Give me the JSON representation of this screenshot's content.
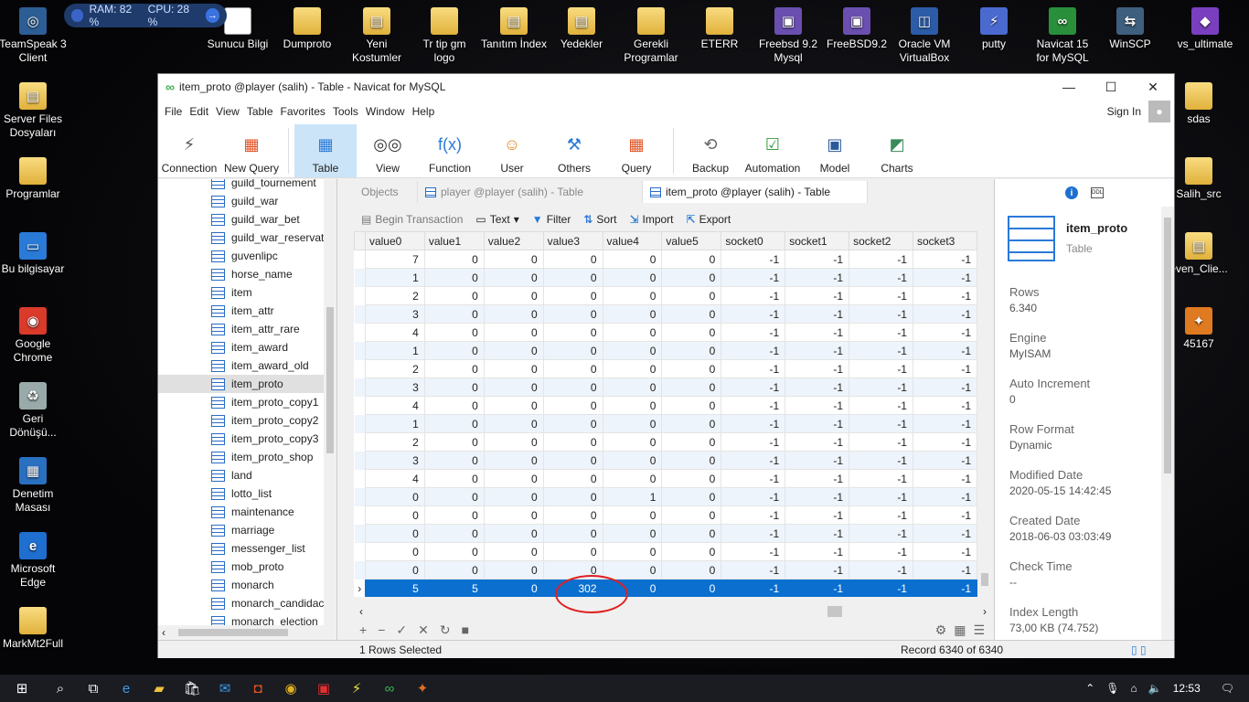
{
  "widget": {
    "ram": "RAM: 82 %",
    "cpu": "CPU: 28 %"
  },
  "desktop_top": [
    {
      "label": "TeamSpeak 3\nClient",
      "icon": "teamspeak-icon"
    },
    {
      "label": "Sunucu Bilgi",
      "icon": "text-file-icon"
    },
    {
      "label": "Dumproto",
      "icon": "folder-icon"
    },
    {
      "label": "Yeni\nKostumler",
      "icon": "archive-icon"
    },
    {
      "label": "Tr tip gm\nlogo",
      "icon": "folder-icon"
    },
    {
      "label": "Tanıtım İndex",
      "icon": "archive-icon"
    },
    {
      "label": "Yedekler",
      "icon": "archive-icon"
    },
    {
      "label": "Gerekli\nProgramlar",
      "icon": "folder-icon"
    },
    {
      "label": "ETERR",
      "icon": "folder-icon"
    },
    {
      "label": "Freebsd 9.2\nMysql",
      "icon": "virtualbox-vm-icon"
    },
    {
      "label": "FreeBSD9.2",
      "icon": "virtualbox-vm-icon"
    },
    {
      "label": "Oracle VM\nVirtualBox",
      "icon": "virtualbox-icon"
    },
    {
      "label": "putty",
      "icon": "putty-icon"
    },
    {
      "label": "Navicat 15\nfor MySQL",
      "icon": "navicat-icon"
    },
    {
      "label": "WinSCP",
      "icon": "winscp-icon"
    },
    {
      "label": "vs_ultimate",
      "icon": "visual-studio-icon"
    }
  ],
  "desktop_left": [
    {
      "label": "Server Files\nDosyaları",
      "icon": "archive-icon"
    },
    {
      "label": "Programlar",
      "icon": "folder-icon"
    },
    {
      "label": "Bu bilgisayar",
      "icon": "computer-icon"
    },
    {
      "label": "Google\nChrome",
      "icon": "chrome-icon"
    },
    {
      "label": "Geri\nDönüşü...",
      "icon": "recycle-bin-icon"
    },
    {
      "label": "Denetim\nMasası",
      "icon": "control-panel-icon"
    },
    {
      "label": "Microsoft\nEdge",
      "icon": "edge-icon"
    },
    {
      "label": "MarkMt2Full",
      "icon": "folder-icon"
    }
  ],
  "desktop_right": [
    {
      "label": "sdas",
      "icon": "folder-icon"
    },
    {
      "label": "Salih_src",
      "icon": "folder-icon"
    },
    {
      "label": "even_Clie...",
      "icon": "archive-icon"
    },
    {
      "label": "45167",
      "icon": "app-icon"
    }
  ],
  "window": {
    "title": "item_proto @player (salih) - Table - Navicat for MySQL",
    "menu": [
      "File",
      "Edit",
      "View",
      "Table",
      "Favorites",
      "Tools",
      "Window",
      "Help"
    ],
    "signin": "Sign In",
    "toolbar": [
      {
        "label": "Connection",
        "icon": "connection-icon"
      },
      {
        "label": "New Query",
        "icon": "new-query-icon"
      },
      {
        "label": "Table",
        "icon": "table-icon",
        "active": true
      },
      {
        "label": "View",
        "icon": "view-icon"
      },
      {
        "label": "Function",
        "icon": "function-icon"
      },
      {
        "label": "User",
        "icon": "user-icon"
      },
      {
        "label": "Others",
        "icon": "others-icon"
      },
      {
        "label": "Query",
        "icon": "query-icon"
      },
      {
        "label": "Backup",
        "icon": "backup-icon"
      },
      {
        "label": "Automation",
        "icon": "automation-icon"
      },
      {
        "label": "Model",
        "icon": "model-icon"
      },
      {
        "label": "Charts",
        "icon": "charts-icon"
      }
    ]
  },
  "tree": [
    "guild_tournement",
    "guild_war",
    "guild_war_bet",
    "guild_war_reservation",
    "guvenlipc",
    "horse_name",
    "item",
    "item_attr",
    "item_attr_rare",
    "item_award",
    "item_award_old",
    "item_proto",
    "item_proto_copy1",
    "item_proto_copy2",
    "item_proto_copy3",
    "item_proto_shop",
    "land",
    "lotto_list",
    "maintenance",
    "marriage",
    "messenger_list",
    "mob_proto",
    "monarch",
    "monarch_candidacy",
    "monarch_election"
  ],
  "tree_selected": "item_proto",
  "tabs": [
    {
      "label": "Objects"
    },
    {
      "label": "player @player (salih) - Table"
    },
    {
      "label": "item_proto @player (salih) - Table"
    }
  ],
  "subtoolbar": {
    "begin_transaction": "Begin Transaction",
    "text": "Text",
    "filter": "Filter",
    "sort": "Sort",
    "import": "Import",
    "export": "Export"
  },
  "grid": {
    "columns": [
      "value0",
      "value1",
      "value2",
      "value3",
      "value4",
      "value5",
      "socket0",
      "socket1",
      "socket2",
      "socket3"
    ],
    "rows": [
      [
        "7",
        "0",
        "0",
        "0",
        "0",
        "0",
        "-1",
        "-1",
        "-1",
        "-1"
      ],
      [
        "1",
        "0",
        "0",
        "0",
        "0",
        "0",
        "-1",
        "-1",
        "-1",
        "-1"
      ],
      [
        "2",
        "0",
        "0",
        "0",
        "0",
        "0",
        "-1",
        "-1",
        "-1",
        "-1"
      ],
      [
        "3",
        "0",
        "0",
        "0",
        "0",
        "0",
        "-1",
        "-1",
        "-1",
        "-1"
      ],
      [
        "4",
        "0",
        "0",
        "0",
        "0",
        "0",
        "-1",
        "-1",
        "-1",
        "-1"
      ],
      [
        "1",
        "0",
        "0",
        "0",
        "0",
        "0",
        "-1",
        "-1",
        "-1",
        "-1"
      ],
      [
        "2",
        "0",
        "0",
        "0",
        "0",
        "0",
        "-1",
        "-1",
        "-1",
        "-1"
      ],
      [
        "3",
        "0",
        "0",
        "0",
        "0",
        "0",
        "-1",
        "-1",
        "-1",
        "-1"
      ],
      [
        "4",
        "0",
        "0",
        "0",
        "0",
        "0",
        "-1",
        "-1",
        "-1",
        "-1"
      ],
      [
        "1",
        "0",
        "0",
        "0",
        "0",
        "0",
        "-1",
        "-1",
        "-1",
        "-1"
      ],
      [
        "2",
        "0",
        "0",
        "0",
        "0",
        "0",
        "-1",
        "-1",
        "-1",
        "-1"
      ],
      [
        "3",
        "0",
        "0",
        "0",
        "0",
        "0",
        "-1",
        "-1",
        "-1",
        "-1"
      ],
      [
        "4",
        "0",
        "0",
        "0",
        "0",
        "0",
        "-1",
        "-1",
        "-1",
        "-1"
      ],
      [
        "0",
        "0",
        "0",
        "0",
        "1",
        "0",
        "-1",
        "-1",
        "-1",
        "-1"
      ],
      [
        "0",
        "0",
        "0",
        "0",
        "0",
        "0",
        "-1",
        "-1",
        "-1",
        "-1"
      ],
      [
        "0",
        "0",
        "0",
        "0",
        "0",
        "0",
        "-1",
        "-1",
        "-1",
        "-1"
      ],
      [
        "0",
        "0",
        "0",
        "0",
        "0",
        "0",
        "-1",
        "-1",
        "-1",
        "-1"
      ],
      [
        "0",
        "0",
        "0",
        "0",
        "0",
        "0",
        "-1",
        "-1",
        "-1",
        "-1"
      ],
      [
        "5",
        "5",
        "0",
        "302",
        "0",
        "0",
        "-1",
        "-1",
        "-1",
        "-1"
      ]
    ],
    "selected_row": 18
  },
  "status": {
    "selected": "1 Rows Selected",
    "record": "Record 6340 of 6340"
  },
  "info": {
    "name": "item_proto",
    "type": "Table",
    "fields": [
      {
        "label": "Rows",
        "value": "6.340"
      },
      {
        "label": "Engine",
        "value": "MyISAM"
      },
      {
        "label": "Auto Increment",
        "value": "0"
      },
      {
        "label": "Row Format",
        "value": "Dynamic"
      },
      {
        "label": "Modified Date",
        "value": "2020-05-15 14:42:45"
      },
      {
        "label": "Created Date",
        "value": "2018-06-03 03:03:49"
      },
      {
        "label": "Check Time",
        "value": "--"
      },
      {
        "label": "Index Length",
        "value": "73,00 KB (74.752)"
      }
    ]
  },
  "taskbar": {
    "clock": "12:53"
  },
  "colors": {
    "selection": "#0b6fcf",
    "accent": "#2a7ad8",
    "annotation": "#e02020"
  }
}
